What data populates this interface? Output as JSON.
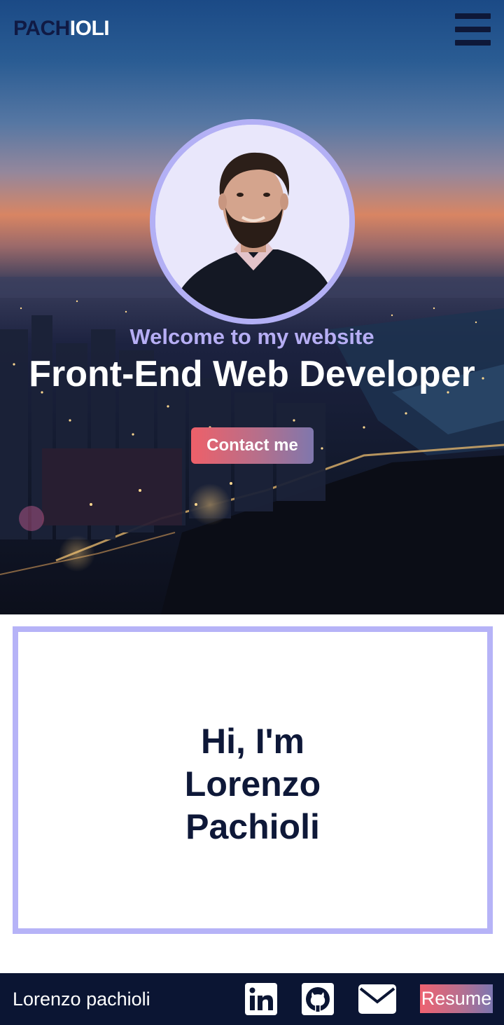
{
  "header": {
    "logo_part1": "PACH",
    "logo_part2": "IOLI",
    "menu_icon": "hamburger-menu-icon"
  },
  "hero": {
    "welcome": "Welcome to my website",
    "title": "Front-End Web Developer",
    "contact_button": "Contact me",
    "avatar_alt": "profile photo"
  },
  "intro": {
    "line1": "Hi, I'm",
    "line2": "Lorenzo",
    "line3": "Pachioli"
  },
  "footer": {
    "name": "Lorenzo pachioli",
    "icons": [
      "linkedin-icon",
      "github-icon",
      "email-icon"
    ],
    "resume_button": "Resume"
  },
  "colors": {
    "navy": "#0e1838",
    "lavender": "#b6b3f7",
    "button_gradient_start": "#ee6069",
    "button_gradient_end": "#7f77ad"
  }
}
